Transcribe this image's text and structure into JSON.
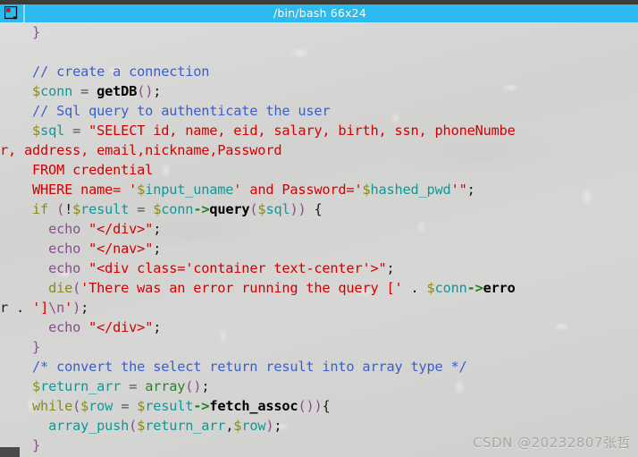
{
  "window": {
    "title": "/bin/bash 66x24",
    "menu_icon": "window-panes-icon",
    "app": "terminal"
  },
  "watermark": {
    "text": "CSDN @20232807张哲"
  },
  "colors": {
    "titlebar_bg": "#2cbbee",
    "titlebar_text": "#ffffff",
    "terminal_bg": "#d3d3d1",
    "comment": "#3a5fcd",
    "string": "#d40000",
    "variable": "#0f9999",
    "sigil": "#8a8a1e",
    "keyword": "#8a8a1e",
    "function": "#000000",
    "punctuation": "#8a4f8a",
    "operator": "#555555",
    "builtin": "#2f7f2f",
    "desktop": "#3b3b39"
  },
  "terminal": {
    "language": "php",
    "lines": [
      {
        "tokens": [
          {
            "t": "    ",
            "c": "t-default"
          },
          {
            "t": "}",
            "c": "t-brace"
          }
        ]
      },
      {
        "tokens": [
          {
            "t": "",
            "c": "t-default"
          }
        ]
      },
      {
        "tokens": [
          {
            "t": "    ",
            "c": "t-default"
          },
          {
            "t": "// create a connection",
            "c": "t-comment"
          }
        ]
      },
      {
        "tokens": [
          {
            "t": "    ",
            "c": "t-default"
          },
          {
            "t": "$",
            "c": "t-sigil"
          },
          {
            "t": "conn",
            "c": "t-var"
          },
          {
            "t": " ",
            "c": "t-default"
          },
          {
            "t": "=",
            "c": "t-op"
          },
          {
            "t": " ",
            "c": "t-default"
          },
          {
            "t": "getDB",
            "c": "t-func"
          },
          {
            "t": "()",
            "c": "t-punct"
          },
          {
            "t": ";",
            "c": "t-default"
          }
        ]
      },
      {
        "tokens": [
          {
            "t": "    ",
            "c": "t-default"
          },
          {
            "t": "// Sql query to authenticate the user",
            "c": "t-comment"
          }
        ]
      },
      {
        "tokens": [
          {
            "t": "    ",
            "c": "t-default"
          },
          {
            "t": "$",
            "c": "t-sigil"
          },
          {
            "t": "sql",
            "c": "t-var"
          },
          {
            "t": " ",
            "c": "t-default"
          },
          {
            "t": "=",
            "c": "t-op"
          },
          {
            "t": " ",
            "c": "t-default"
          },
          {
            "t": "\"SELECT id, name, eid, salary, birth, ssn, phoneNumbe",
            "c": "t-string"
          }
        ]
      },
      {
        "tokens": [
          {
            "t": "r, address, email,nickname,Password",
            "c": "t-string"
          }
        ]
      },
      {
        "tokens": [
          {
            "t": "    FROM credential",
            "c": "t-string"
          }
        ]
      },
      {
        "tokens": [
          {
            "t": "    WHERE name= '",
            "c": "t-string"
          },
          {
            "t": "$",
            "c": "t-sigil"
          },
          {
            "t": "input_uname",
            "c": "t-var"
          },
          {
            "t": "' and Password='",
            "c": "t-string"
          },
          {
            "t": "$",
            "c": "t-sigil"
          },
          {
            "t": "hashed_pwd",
            "c": "t-var"
          },
          {
            "t": "'\"",
            "c": "t-string"
          },
          {
            "t": ";",
            "c": "t-default"
          }
        ]
      },
      {
        "tokens": [
          {
            "t": "    ",
            "c": "t-default"
          },
          {
            "t": "if",
            "c": "t-kw"
          },
          {
            "t": " ",
            "c": "t-default"
          },
          {
            "t": "(",
            "c": "t-punct"
          },
          {
            "t": "!",
            "c": "t-default"
          },
          {
            "t": "$",
            "c": "t-sigil"
          },
          {
            "t": "result",
            "c": "t-var"
          },
          {
            "t": " ",
            "c": "t-default"
          },
          {
            "t": "=",
            "c": "t-op"
          },
          {
            "t": " ",
            "c": "t-default"
          },
          {
            "t": "$",
            "c": "t-sigil"
          },
          {
            "t": "conn",
            "c": "t-var"
          },
          {
            "t": "->",
            "c": "t-arrow"
          },
          {
            "t": "query",
            "c": "t-func"
          },
          {
            "t": "(",
            "c": "t-punct"
          },
          {
            "t": "$",
            "c": "t-sigil"
          },
          {
            "t": "sql",
            "c": "t-var"
          },
          {
            "t": "))",
            "c": "t-punct"
          },
          {
            "t": " ",
            "c": "t-default"
          },
          {
            "t": "{",
            "c": "t-default"
          }
        ]
      },
      {
        "tokens": [
          {
            "t": "      ",
            "c": "t-default"
          },
          {
            "t": "echo",
            "c": "t-punct"
          },
          {
            "t": " ",
            "c": "t-default"
          },
          {
            "t": "\"</div>\"",
            "c": "t-string"
          },
          {
            "t": ";",
            "c": "t-default"
          }
        ]
      },
      {
        "tokens": [
          {
            "t": "      ",
            "c": "t-default"
          },
          {
            "t": "echo",
            "c": "t-punct"
          },
          {
            "t": " ",
            "c": "t-default"
          },
          {
            "t": "\"</nav>\"",
            "c": "t-string"
          },
          {
            "t": ";",
            "c": "t-default"
          }
        ]
      },
      {
        "tokens": [
          {
            "t": "      ",
            "c": "t-default"
          },
          {
            "t": "echo",
            "c": "t-punct"
          },
          {
            "t": " ",
            "c": "t-default"
          },
          {
            "t": "\"<div class='container text-center'>\"",
            "c": "t-string"
          },
          {
            "t": ";",
            "c": "t-default"
          }
        ]
      },
      {
        "tokens": [
          {
            "t": "      ",
            "c": "t-default"
          },
          {
            "t": "die",
            "c": "t-kw"
          },
          {
            "t": "(",
            "c": "t-punct"
          },
          {
            "t": "'There was an error running the query ['",
            "c": "t-string"
          },
          {
            "t": " ",
            "c": "t-default"
          },
          {
            "t": ".",
            "c": "t-default"
          },
          {
            "t": " ",
            "c": "t-default"
          },
          {
            "t": "$",
            "c": "t-sigil"
          },
          {
            "t": "conn",
            "c": "t-var"
          },
          {
            "t": "->",
            "c": "t-arrow"
          },
          {
            "t": "erro",
            "c": "t-func"
          }
        ]
      },
      {
        "tokens": [
          {
            "t": "r ",
            "c": "t-default"
          },
          {
            "t": ".",
            "c": "t-default"
          },
          {
            "t": " ",
            "c": "t-default"
          },
          {
            "t": "']",
            "c": "t-string"
          },
          {
            "t": "\\n",
            "c": "t-esc"
          },
          {
            "t": "'",
            "c": "t-string"
          },
          {
            "t": ")",
            "c": "t-punct"
          },
          {
            "t": ";",
            "c": "t-default"
          }
        ]
      },
      {
        "tokens": [
          {
            "t": "      ",
            "c": "t-default"
          },
          {
            "t": "echo",
            "c": "t-punct"
          },
          {
            "t": " ",
            "c": "t-default"
          },
          {
            "t": "\"</div>\"",
            "c": "t-string"
          },
          {
            "t": ";",
            "c": "t-default"
          }
        ]
      },
      {
        "tokens": [
          {
            "t": "    ",
            "c": "t-default"
          },
          {
            "t": "}",
            "c": "t-brace"
          }
        ]
      },
      {
        "tokens": [
          {
            "t": "    ",
            "c": "t-default"
          },
          {
            "t": "/* convert the select return result into array type */",
            "c": "t-comment"
          }
        ]
      },
      {
        "tokens": [
          {
            "t": "    ",
            "c": "t-default"
          },
          {
            "t": "$",
            "c": "t-sigil"
          },
          {
            "t": "return_arr",
            "c": "t-var"
          },
          {
            "t": " ",
            "c": "t-default"
          },
          {
            "t": "=",
            "c": "t-op"
          },
          {
            "t": " ",
            "c": "t-default"
          },
          {
            "t": "array",
            "c": "t-builtin"
          },
          {
            "t": "()",
            "c": "t-punct"
          },
          {
            "t": ";",
            "c": "t-default"
          }
        ]
      },
      {
        "tokens": [
          {
            "t": "    ",
            "c": "t-default"
          },
          {
            "t": "while",
            "c": "t-kw"
          },
          {
            "t": "(",
            "c": "t-punct"
          },
          {
            "t": "$",
            "c": "t-sigil"
          },
          {
            "t": "row",
            "c": "t-var"
          },
          {
            "t": " ",
            "c": "t-default"
          },
          {
            "t": "=",
            "c": "t-op"
          },
          {
            "t": " ",
            "c": "t-default"
          },
          {
            "t": "$",
            "c": "t-sigil"
          },
          {
            "t": "result",
            "c": "t-var"
          },
          {
            "t": "->",
            "c": "t-arrow"
          },
          {
            "t": "fetch_assoc",
            "c": "t-func"
          },
          {
            "t": "())",
            "c": "t-punct"
          },
          {
            "t": "{",
            "c": "t-default"
          }
        ]
      },
      {
        "tokens": [
          {
            "t": "      ",
            "c": "t-default"
          },
          {
            "t": "array_push",
            "c": "t-var"
          },
          {
            "t": "(",
            "c": "t-punct"
          },
          {
            "t": "$",
            "c": "t-sigil"
          },
          {
            "t": "return_arr",
            "c": "t-var"
          },
          {
            "t": ",",
            "c": "t-default"
          },
          {
            "t": "$",
            "c": "t-sigil"
          },
          {
            "t": "row",
            "c": "t-var"
          },
          {
            "t": ")",
            "c": "t-punct"
          },
          {
            "t": ";",
            "c": "t-default"
          }
        ]
      },
      {
        "tokens": [
          {
            "t": "    ",
            "c": "t-default"
          },
          {
            "t": "}",
            "c": "t-brace"
          }
        ]
      }
    ]
  }
}
